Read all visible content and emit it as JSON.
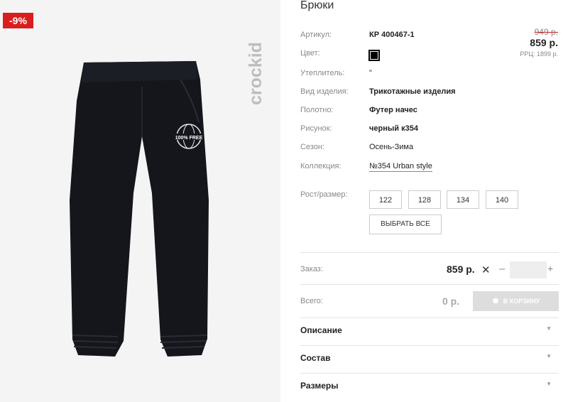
{
  "badge": "-9%",
  "brand": "crockid",
  "print_text": "100% FREE",
  "product": {
    "title": "Брюки",
    "rows": [
      {
        "label": "Артикул:",
        "value": "КР 400467-1"
      },
      {
        "label": "Цвет:",
        "value": ""
      },
      {
        "label": "Утеплитель:",
        "value": "\""
      },
      {
        "label": "Вид изделия:",
        "value": "Трикотажные изделия"
      },
      {
        "label": "Полотно:",
        "value": "Футер начес"
      },
      {
        "label": "Рисунок:",
        "value": "черный к354"
      },
      {
        "label": "Сезон:",
        "value": "Осень-Зима"
      },
      {
        "label": "Коллекция:",
        "value": "№354 Urban style"
      }
    ],
    "color_hex": "#000000"
  },
  "pricing": {
    "old_price": "949 р.",
    "price": "859 р.",
    "rrp": "РРЦ: 1899 р."
  },
  "sizes": {
    "label": "Рост/размер:",
    "options": [
      "122",
      "128",
      "134",
      "140"
    ],
    "select_all": "ВЫБРАТЬ ВСЕ"
  },
  "order": {
    "label": "Заказ:",
    "price": "859 р.",
    "times": "✕",
    "minus": "–",
    "plus": "+",
    "qty": ""
  },
  "total": {
    "label": "Всего:",
    "value": "0 р.",
    "cart_button": "В КОРЗИНУ",
    "cart_icon": "basket-icon"
  },
  "accordion": [
    {
      "title": "Описание",
      "icon": "caret-down-icon"
    },
    {
      "title": "Состав",
      "icon": "caret-down-icon"
    },
    {
      "title": "Размеры",
      "icon": "caret-down-icon"
    }
  ],
  "colors": {
    "badge": "#d81e1e",
    "pants": "#14161c"
  }
}
